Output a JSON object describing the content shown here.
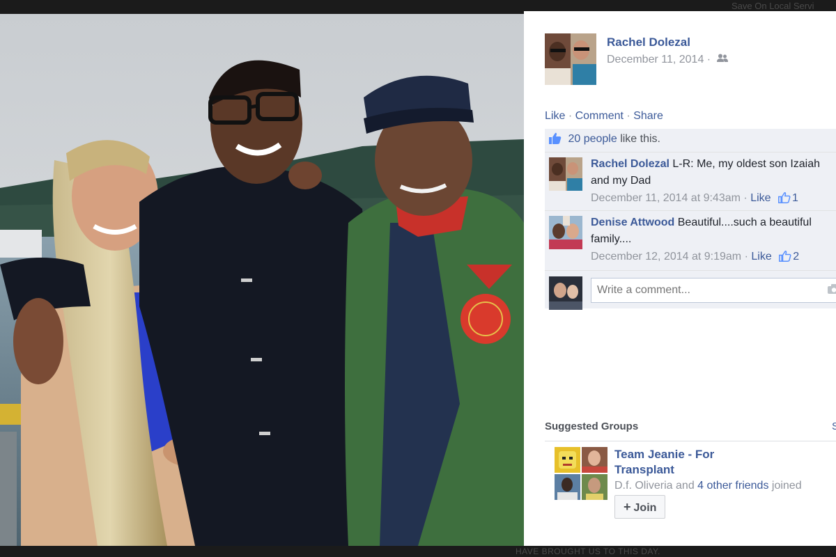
{
  "frame": {
    "top_ad_text": "Save On Local Servi",
    "bottom_text": "HAVE BROUGHT US TO THIS DAY."
  },
  "post": {
    "author": "Rachel Dolezal",
    "date": "December 11, 2014",
    "date_separator": "·",
    "audience_icon": "friends-icon",
    "actions": {
      "like": "Like",
      "comment": "Comment",
      "share": "Share",
      "separator": "·"
    },
    "likes": {
      "count_label": "20 people",
      "suffix": " like this."
    },
    "comments": [
      {
        "author": "Rachel Dolezal",
        "text": "L-R: Me, my oldest son Izaiah and my Dad",
        "time": "December 11, 2014 at 9:43am",
        "like_label": "Like",
        "like_count": "1"
      },
      {
        "author": "Denise Attwood",
        "text": "Beautiful....such a beautiful family....",
        "time": "December 12, 2014 at 9:19am",
        "like_label": "Like",
        "like_count": "2"
      }
    ],
    "write_comment_placeholder": "Write a comment..."
  },
  "suggested_groups": {
    "header": "Suggested Groups",
    "see_all": "S",
    "group": {
      "name": "Team Jeanie - For Transplant",
      "joined_friend": "D.f. Oliveria",
      "joined_and": " and ",
      "joined_others": "4 other friends",
      "joined_suffix": " joined",
      "join_label": "Join"
    }
  },
  "colors": {
    "link_blue": "#3b5998",
    "meta_gray": "#90949c",
    "ufi_bg": "#eef0f5",
    "frame_dark": "#1b1b1b"
  }
}
